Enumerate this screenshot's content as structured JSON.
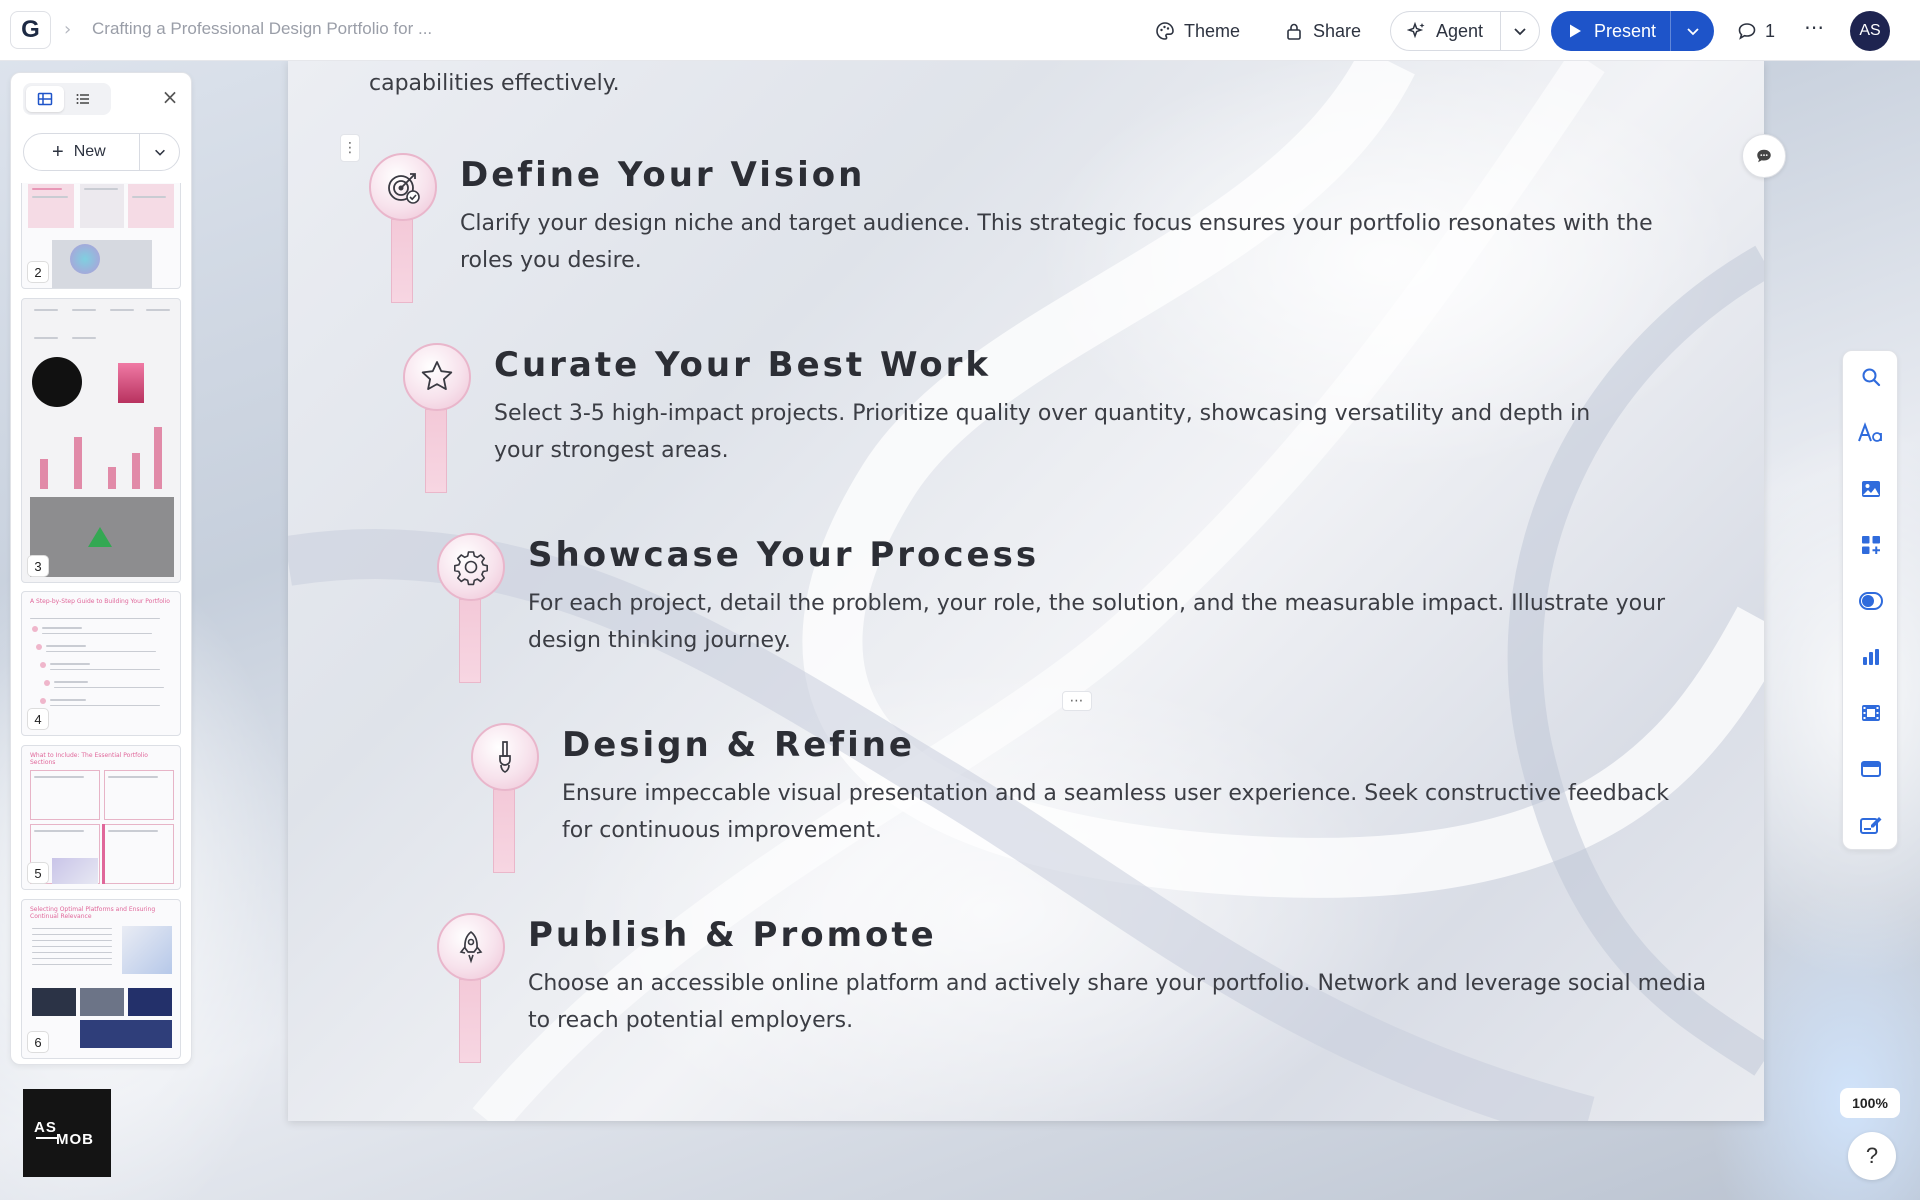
{
  "topbar": {
    "doc_title": "Crafting a Professional Design Portfolio for ...",
    "theme_label": "Theme",
    "share_label": "Share",
    "agent_label": "Agent",
    "present_label": "Present",
    "comment_count": "1",
    "avatar_initials": "AS",
    "logo_letter": "G"
  },
  "panel": {
    "new_label": "New",
    "thumbnails": [
      {
        "number": "2"
      },
      {
        "number": "3"
      },
      {
        "number": "4",
        "title": "A Step-by-Step Guide to Building Your Portfolio"
      },
      {
        "number": "5",
        "title": "What to Include: The Essential Portfolio Sections"
      },
      {
        "number": "6",
        "title": "Selecting Optimal Platforms and Ensuring Continual Relevance"
      }
    ]
  },
  "slide": {
    "intro_tail": "capabilities effectively.",
    "steps": [
      {
        "title": "Define Your Vision",
        "desc": "Clarify your design niche and target audience. This strategic focus ensures your portfolio resonates with the roles you desire.",
        "icon": "target-icon"
      },
      {
        "title": "Curate Your Best Work",
        "desc": "Select 3-5 high-impact projects. Prioritize quality over quantity, showcasing versatility and depth in your strongest areas.",
        "icon": "star-icon"
      },
      {
        "title": "Showcase Your Process",
        "desc": "For each project, detail the problem, your role, the solution, and the measurable impact. Illustrate your design thinking journey.",
        "icon": "gear-icon"
      },
      {
        "title": "Design & Refine",
        "desc": "Ensure impeccable visual presentation and a seamless user experience. Seek constructive feedback for continuous improvement.",
        "icon": "brush-icon"
      },
      {
        "title": "Publish & Promote",
        "desc": "Choose an accessible online platform and actively share your portfolio. Network and leverage social media to reach potential employers.",
        "icon": "rocket-icon"
      }
    ]
  },
  "zoom_level": "100%",
  "help_label": "?",
  "brand": {
    "line1": "AS",
    "line2": "MOB"
  },
  "colors": {
    "accent": "#1e54c9",
    "step_pink": "#eec2d5"
  }
}
